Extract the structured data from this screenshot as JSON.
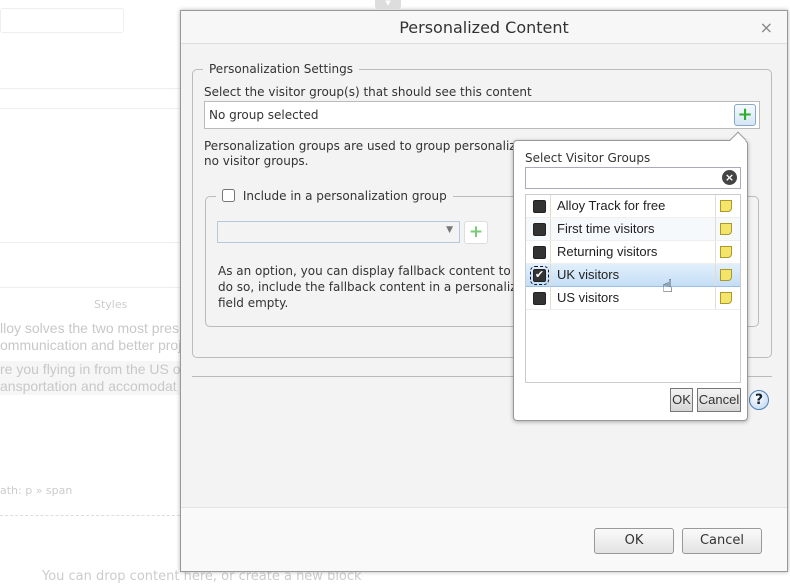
{
  "background": {
    "rte_styles": "Styles",
    "text_lines": [
      "lloy solves the two most pres",
      "ommunication and better proj",
      "re you flying in from the US o",
      "ansportation and accomodat"
    ],
    "path": "ath: p » span",
    "drop_text": "You can drop content here, or create a new block"
  },
  "dialog": {
    "title": "Personalized Content",
    "close_icon": "×",
    "settings_legend": "Personalization Settings",
    "select_label": "Select the visitor group(s) that should see this content",
    "groups_value": "No group selected",
    "groups_info_1": "Personalization groups are used to group personalize",
    "groups_info_2": "no visitor groups.",
    "include_label": "Include in a personalization group",
    "fallback_1": "As an option, you can display fallback content to vis",
    "fallback_2": "do so, include the fallback content in a personalizat",
    "fallback_3": "field empty.",
    "ok": "OK",
    "cancel": "Cancel",
    "help": "?"
  },
  "popup": {
    "title": "Select Visitor Groups",
    "search_value": "",
    "items": [
      {
        "label": "Alloy Track for free",
        "checked": false
      },
      {
        "label": "First time visitors",
        "checked": false
      },
      {
        "label": "Returning visitors",
        "checked": false
      },
      {
        "label": "UK visitors",
        "checked": true
      },
      {
        "label": "US visitors",
        "checked": false
      }
    ],
    "ok": "OK",
    "cancel": "Cancel"
  },
  "colors": {
    "accent_add": "#2eac2e",
    "selected_row": "#cfe4f8"
  }
}
